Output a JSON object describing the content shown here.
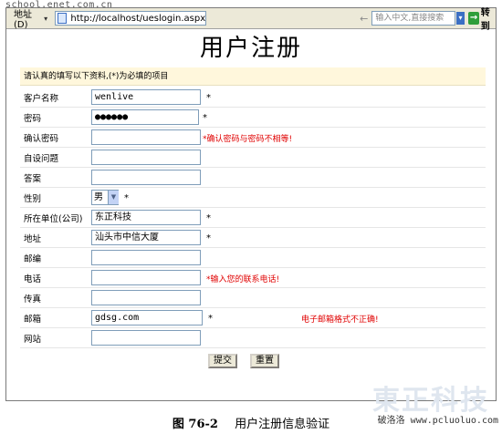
{
  "watermark_top": "school.enet.com.cn",
  "browser": {
    "address_label": "地址(D)",
    "url": "http://localhost/ueslogin.aspx",
    "search_placeholder": "输入中文,直接搜索",
    "go_label": "转到"
  },
  "page": {
    "title": "用户注册",
    "hint": "请认真的填写以下资料,(*)为必填的项目"
  },
  "form": {
    "rows": [
      {
        "label": "客户名称",
        "value": "wenlive",
        "required": "*",
        "error": ""
      },
      {
        "label": "密码",
        "value": "●●●●●●",
        "required": "*",
        "error": ""
      },
      {
        "label": "确认密码",
        "value": "",
        "required": "",
        "error": "*确认密码与密码不相等!"
      },
      {
        "label": "自设问题",
        "value": "",
        "required": "",
        "error": ""
      },
      {
        "label": "答案",
        "value": "",
        "required": "",
        "error": ""
      },
      {
        "label": "性别",
        "value": "男",
        "required": "*",
        "error": ""
      },
      {
        "label": "所在单位(公司)",
        "value": "东正科技",
        "required": "*",
        "error": ""
      },
      {
        "label": "地址",
        "value": "汕头市中信大厦",
        "required": "*",
        "error": ""
      },
      {
        "label": "邮编",
        "value": "",
        "required": "",
        "error": ""
      },
      {
        "label": "电话",
        "value": "",
        "required": "",
        "error": "*输入您的联系电话!"
      },
      {
        "label": "传真",
        "value": "",
        "required": "",
        "error": ""
      },
      {
        "label": "邮箱",
        "value": "gdsg.com",
        "required": "*",
        "error": "电子邮箱格式不正确!"
      },
      {
        "label": "网站",
        "value": "",
        "required": "",
        "error": ""
      }
    ],
    "submit_label": "提交",
    "reset_label": "重置"
  },
  "caption": {
    "number": "图 76-2",
    "text": "用户注册信息验证"
  },
  "watermark_bottom": "www.pcluoluo.com",
  "watermark_bottom_cn": "破洛洛"
}
